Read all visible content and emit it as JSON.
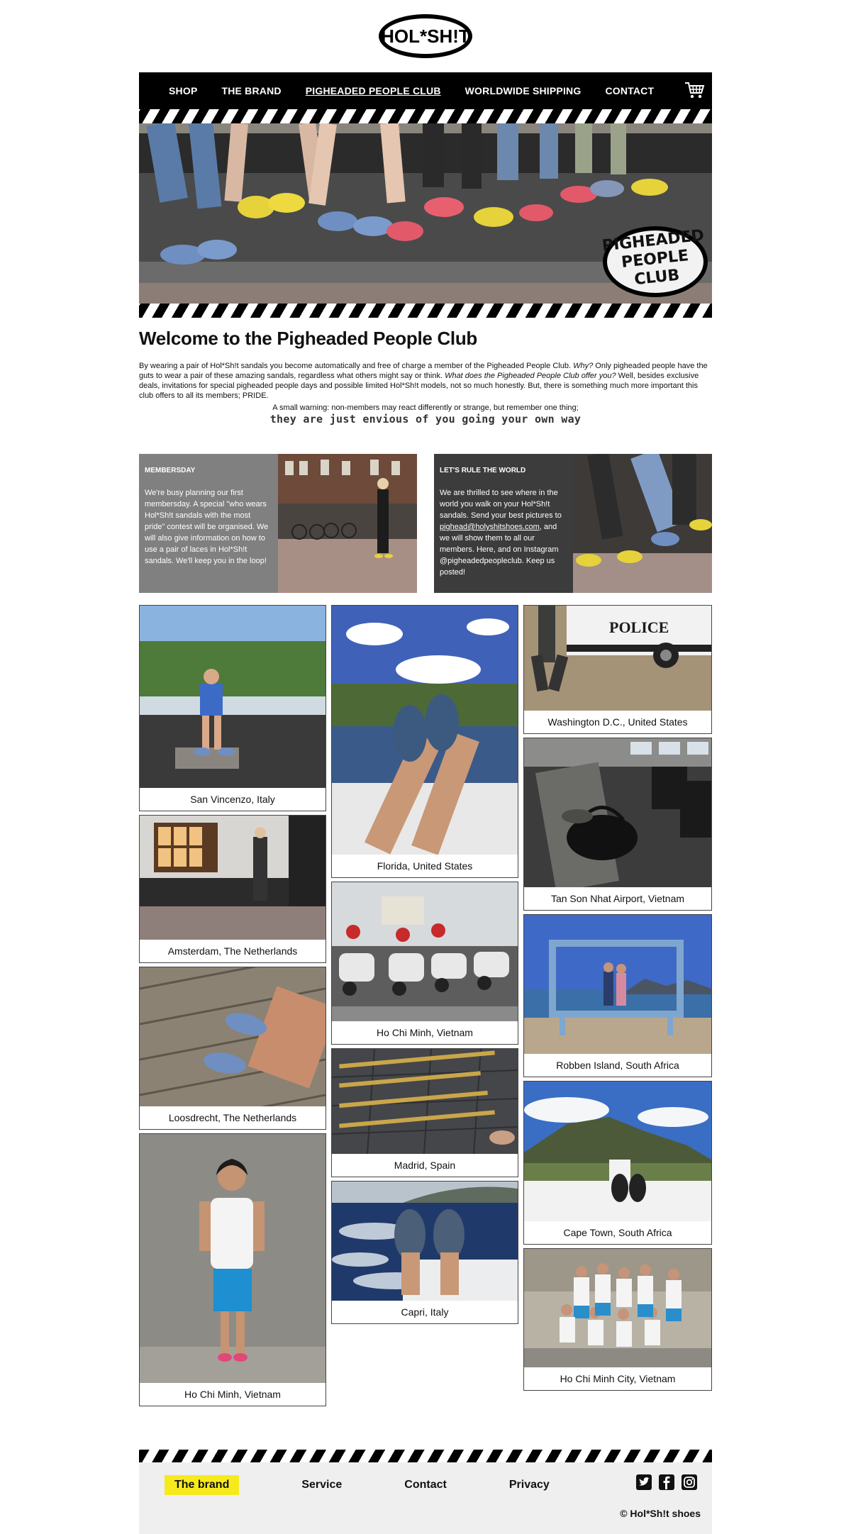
{
  "brand": {
    "logo_text": "HOL*SH!T"
  },
  "nav": {
    "items": [
      {
        "label": "SHOP"
      },
      {
        "label": "THE BRAND"
      },
      {
        "label": "PIGHEADED PEOPLE CLUB",
        "active": true
      },
      {
        "label": "WORLDWIDE SHIPPING"
      },
      {
        "label": "CONTACT"
      }
    ],
    "cart_icon": "cart-icon"
  },
  "hero": {
    "badge_lines": [
      "PIGHEADED",
      "PEOPLE",
      "CLUB"
    ]
  },
  "intro": {
    "title": "Welcome to the Pigheaded People Club",
    "p1_a": "By wearing a pair of Hol*Sh!t sandals you become automatically and free of charge a member of the Pigheaded People Club. ",
    "p1_b": "Why?",
    "p1_c": " Only pigheaded people have the guts to wear a pair of these amazing sandals, regardless what others might say or think. ",
    "p1_d": "What does the Pigheaded People Club offer you?",
    "p1_e": " Well, besides exclusive deals, invitations for special pigheaded people days and possible limited Hol*Sh!t models, not so much honestly. But, there is something much more important this club offers to all its members; PRIDE.",
    "warning": "A small warning: non-members may react differently or strange, but remember one thing;",
    "quote": "they are just envious of you going your own way"
  },
  "cards": {
    "left": {
      "title": "MEMBERSDAY",
      "body": "We're busy planning our first membersday. A special \"who wears Hol*Sh!t sandals with the most pride\" contest will be organised. We will also give information on how to use a pair of laces in Hol*Sh!t sandals. We'll keep you in the loop!"
    },
    "right": {
      "title": "LET'S RULE THE WORLD",
      "body_a": "We are thrilled to see where in the world you walk on your Hol*Sh!t sandals. Send your best pictures to ",
      "email": "pighead@holyshitshoes.com",
      "body_b": ", and we will show them to all our members. Here, and on Instagram @pigheadedpeopleclub. Keep us posted!"
    }
  },
  "gallery": {
    "col1": [
      {
        "caption": "San Vincenzo, Italy"
      },
      {
        "caption": "Amsterdam, The Netherlands"
      },
      {
        "caption": "Loosdrecht, The Netherlands"
      },
      {
        "caption": "Ho Chi Minh, Vietnam"
      }
    ],
    "col2": [
      {
        "caption": "Florida, United States"
      },
      {
        "caption": "Ho Chi Minh, Vietnam"
      },
      {
        "caption": "Madrid, Spain"
      },
      {
        "caption": "Capri, Italy"
      }
    ],
    "col3": [
      {
        "caption": "Washington D.C., United States"
      },
      {
        "caption": "Tan Son Nhat Airport, Vietnam"
      },
      {
        "caption": "Robben Island, South Africa"
      },
      {
        "caption": "Cape Town, South Africa"
      },
      {
        "caption": "Ho Chi Minh City, Vietnam"
      }
    ]
  },
  "footer": {
    "links": [
      {
        "label": "The brand",
        "highlight": true
      },
      {
        "label": "Service"
      },
      {
        "label": "Contact"
      },
      {
        "label": "Privacy"
      }
    ],
    "social_icons": [
      "twitter-icon",
      "facebook-icon",
      "instagram-icon"
    ],
    "copyright": "© Hol*Sh!t shoes"
  },
  "colors": {
    "nav_bg": "#000000",
    "highlight_yellow": "#f7ea1c",
    "card_left_bg": "#808080",
    "card_right_bg": "#3c3c3c",
    "footer_bg": "#efefef"
  }
}
